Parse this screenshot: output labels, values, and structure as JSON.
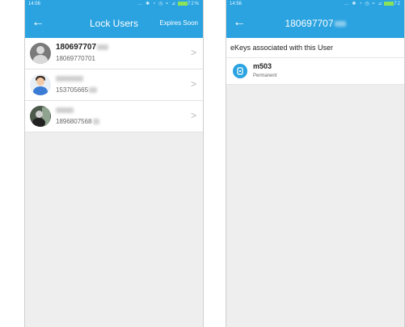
{
  "screens": {
    "left": {
      "status": {
        "time": "14:56",
        "signal": "… ✱ ◔ ◷ ≈ ⊿",
        "battery_label": "72%"
      },
      "title": "Lock Users",
      "action_label": "Expires Soon",
      "users": [
        {
          "name": "180697707",
          "phone": "18069770701",
          "avatar": "default-avatar"
        },
        {
          "name": "",
          "phone": "153705665",
          "avatar": "girl-avatar"
        },
        {
          "name": "",
          "phone": "1896807568",
          "avatar": "photo-avatar"
        }
      ]
    },
    "right": {
      "status": {
        "time": "14:56",
        "signal": "… ✱ ◔ ◷ ≈ ⊿",
        "battery_label": "72"
      },
      "title": "180697707",
      "section_header": "eKeys associated with this User",
      "ekeys": [
        {
          "name": "m503",
          "type": "Permanent",
          "icon": "ekey-icon"
        }
      ]
    }
  },
  "colors": {
    "accent": "#2aa3e0",
    "background": "#eeeeee"
  }
}
